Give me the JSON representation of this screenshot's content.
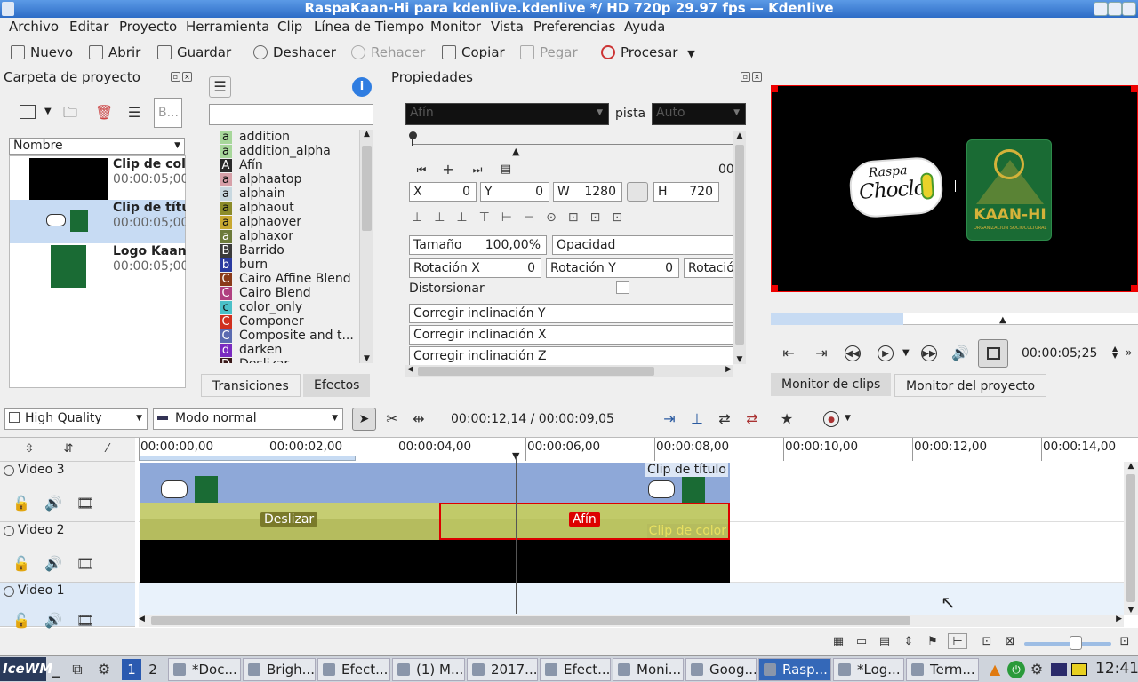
{
  "window": {
    "title": "RaspaKaan-Hi para kdenlive.kdenlive */ HD 720p 29.97 fps — Kdenlive"
  },
  "menu": [
    "Archivo",
    "Editar",
    "Proyecto",
    "Herramienta",
    "Clip",
    "Línea de Tiempo",
    "Monitor",
    "Vista",
    "Preferencias",
    "Ayuda"
  ],
  "toolbar": {
    "new": "Nuevo",
    "open": "Abrir",
    "save": "Guardar",
    "undo": "Deshacer",
    "redo": "Rehacer",
    "copy": "Copiar",
    "paste": "Pegar",
    "render": "Procesar"
  },
  "bin": {
    "title": "Carpeta de proyecto",
    "search_placeholder": "B...",
    "column": "Nombre",
    "items": [
      {
        "name": "Clip de col",
        "duration": "00:00:05;00"
      },
      {
        "name": "Clip de títu",
        "duration": "00:00:05;00"
      },
      {
        "name": "Logo Kaan",
        "duration": "00:00:05;00"
      }
    ]
  },
  "effects": {
    "list": [
      {
        "b": "a",
        "c": "#a7d79a",
        "n": "addition"
      },
      {
        "b": "a",
        "c": "#a7d79a",
        "n": "addition_alpha"
      },
      {
        "b": "A",
        "c": "#2a2a2a",
        "n": "Afín"
      },
      {
        "b": "a",
        "c": "#d6a0a8",
        "n": "alphaatop"
      },
      {
        "b": "a",
        "c": "#c8d8e0",
        "n": "alphain"
      },
      {
        "b": "a",
        "c": "#8c8c2a",
        "n": "alphaout"
      },
      {
        "b": "a",
        "c": "#c8a830",
        "n": "alphaover"
      },
      {
        "b": "a",
        "c": "#6c7a3a",
        "n": "alphaxor"
      },
      {
        "b": "B",
        "c": "#3a3a3a",
        "n": "Barrido"
      },
      {
        "b": "b",
        "c": "#2a3aa0",
        "n": "burn"
      },
      {
        "b": "C",
        "c": "#8a3a1a",
        "n": "Cairo Affine Blend"
      },
      {
        "b": "C",
        "c": "#b04080",
        "n": "Cairo Blend"
      },
      {
        "b": "c",
        "c": "#4ac0c8",
        "n": "color_only"
      },
      {
        "b": "C",
        "c": "#d03020",
        "n": "Componer"
      },
      {
        "b": "C",
        "c": "#5a6ab0",
        "n": "Composite and t..."
      },
      {
        "b": "d",
        "c": "#7a2ac0",
        "n": "darken"
      },
      {
        "b": "D",
        "c": "#3a1a1a",
        "n": "Deslizar"
      }
    ],
    "tab_transitions": "Transiciones",
    "tab_effects": "Efectos"
  },
  "props": {
    "title": "Propiedades",
    "transition": "Afín",
    "track_label": "pista",
    "track": "Auto",
    "time": "00",
    "x_label": "X",
    "x": "0",
    "y_label": "Y",
    "y": "0",
    "w_label": "W",
    "w": "1280",
    "h_label": "H",
    "h": "720",
    "size_label": "Tamaño",
    "size": "100,00%",
    "opacity_label": "Opacidad",
    "rotx_label": "Rotación X",
    "rotx": "0",
    "roty_label": "Rotación Y",
    "roty": "0",
    "rotz_label": "Rotació",
    "distort_label": "Distorsionar",
    "skew_y": "Corregir inclinación Y",
    "skew_x": "Corregir inclinación X",
    "skew_z": "Corregir inclinación Z"
  },
  "monitor": {
    "logo_left_top": "Raspa",
    "logo_left_bottom": "Choclo",
    "logo_right": "KAAN-HI",
    "logo_right_sub": "ORGANIZACIÓN SOCIOCULTURAL",
    "timecode": "00:00:05;25",
    "tab_clip": "Monitor de clips",
    "tab_project": "Monitor del proyecto"
  },
  "timeline_toolbar": {
    "quality": "High Quality",
    "mode": "Modo normal",
    "position": "00:00:12,14 / 00:00:09,05"
  },
  "ruler": [
    "00:00:00,00",
    "00:00:02,00",
    "00:00:04,00",
    "00:00:06,00",
    "00:00:08,00",
    "00:00:10,00",
    "00:00:12,00",
    "00:00:14,00"
  ],
  "tracks": [
    {
      "name": "Video 3"
    },
    {
      "name": "Video 2"
    },
    {
      "name": "Video 1"
    }
  ],
  "clips": {
    "title_clip": "Clip de título",
    "color_clip": "Clip de color",
    "slide": "Deslizar",
    "affine": "Afín"
  },
  "taskbar": {
    "start": "IceWM",
    "ws1": "1",
    "ws2": "2",
    "clock": "12:41",
    "tasks": [
      "*Doc...",
      "Brigh...",
      "Efect...",
      "(1) M...",
      "2017...",
      "Efect...",
      "Moni...",
      "Goog...",
      "Rasp...",
      "*Log...",
      "Term..."
    ]
  }
}
